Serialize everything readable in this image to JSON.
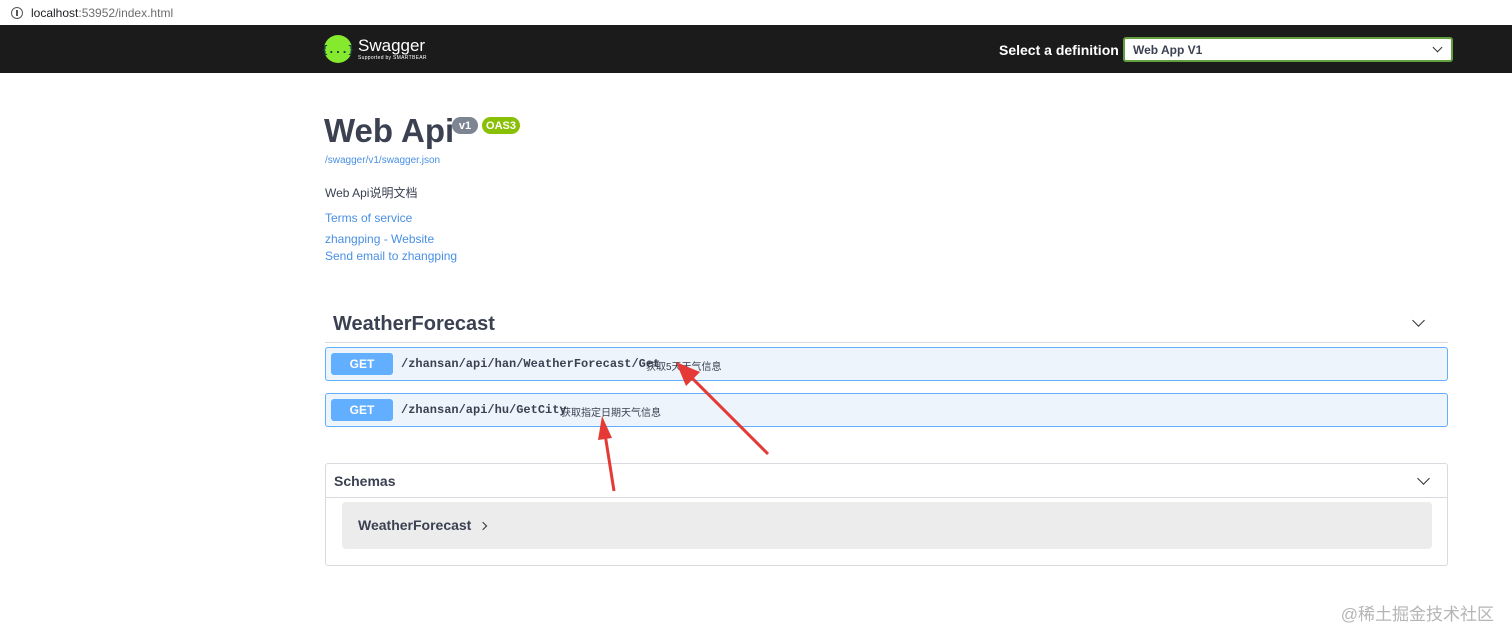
{
  "browser": {
    "url_host": "localhost",
    "url_rest": ":53952/index.html"
  },
  "topbar": {
    "logo_icon": "{...}",
    "logo_name": "Swagger",
    "logo_sub": "Supported by SMARTBEAR",
    "select_label": "Select a definition",
    "selected_definition": "Web App V1"
  },
  "info": {
    "title": "Web Api",
    "version_badge": "v1",
    "oas_badge": "OAS3",
    "spec_url": "/swagger/v1/swagger.json",
    "description": "Web Api说明文档",
    "terms_link": "Terms of service",
    "website_link": "zhangping - Website",
    "email_link": "Send email to zhangping"
  },
  "tag": {
    "name": "WeatherForecast",
    "operations": [
      {
        "method": "GET",
        "path": "/zhansan/api/han/WeatherForecast/Get",
        "summary": "获取5天天气信息"
      },
      {
        "method": "GET",
        "path": "/zhansan/api/hu/GetCity",
        "summary": "获取指定日期天气信息"
      }
    ]
  },
  "schemas": {
    "title": "Schemas",
    "models": [
      "WeatherForecast"
    ]
  },
  "annotation": {
    "arrow_color": "#e53935"
  },
  "watermark": "@稀土掘金技术社区",
  "colors": {
    "topbar_bg": "#1b1b1b",
    "get_method": "#61affe",
    "get_block_bg": "#eef4fb",
    "oas_badge": "#89bf04",
    "version_badge": "#7d8492",
    "link": "#4990e2",
    "logo": "#85ea2d"
  }
}
